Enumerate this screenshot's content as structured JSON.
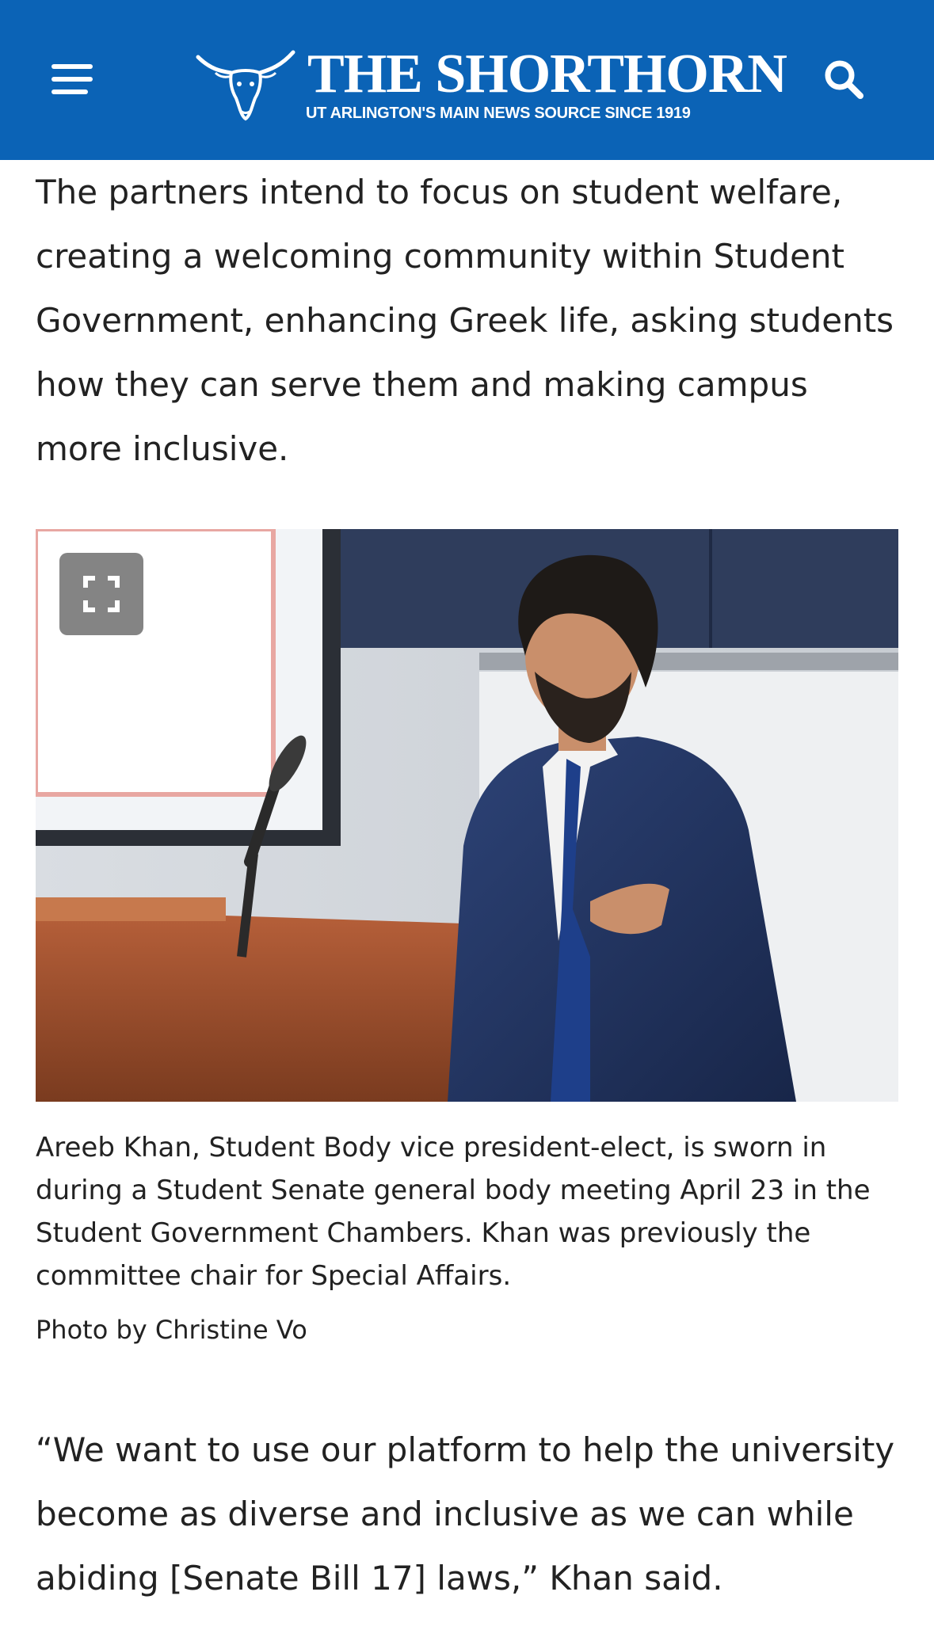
{
  "header": {
    "background": "#0b63b6",
    "menu_icon": "hamburger-menu-icon",
    "search_icon": "search-icon",
    "logo_title": "The Shorthorn",
    "logo_tagline": "UT ARLINGTON'S MAIN NEWS SOURCE SINCE 1919",
    "logo_icon": "longhorn-logo-icon"
  },
  "article": {
    "paragraph_1": "The partners intend to focus on student welfare, creating a welcoming community within Student Government, enhancing Greek life, asking students how they can serve them and making campus more inclusive.",
    "photo": {
      "expand_icon": "fullscreen-expand-icon",
      "caption": "Areeb Khan, Student Body vice president-elect, is sworn in during a Student Senate general body meeting April 23 in the Student Government Chambers. Khan was previously the committee chair for Special Affairs.",
      "credit": "Photo by Christine Vo"
    },
    "paragraph_2": "“We want to use our platform to help the university become as diverse and inclusive as we can while abiding [Senate Bill 17] laws,” Khan said."
  }
}
